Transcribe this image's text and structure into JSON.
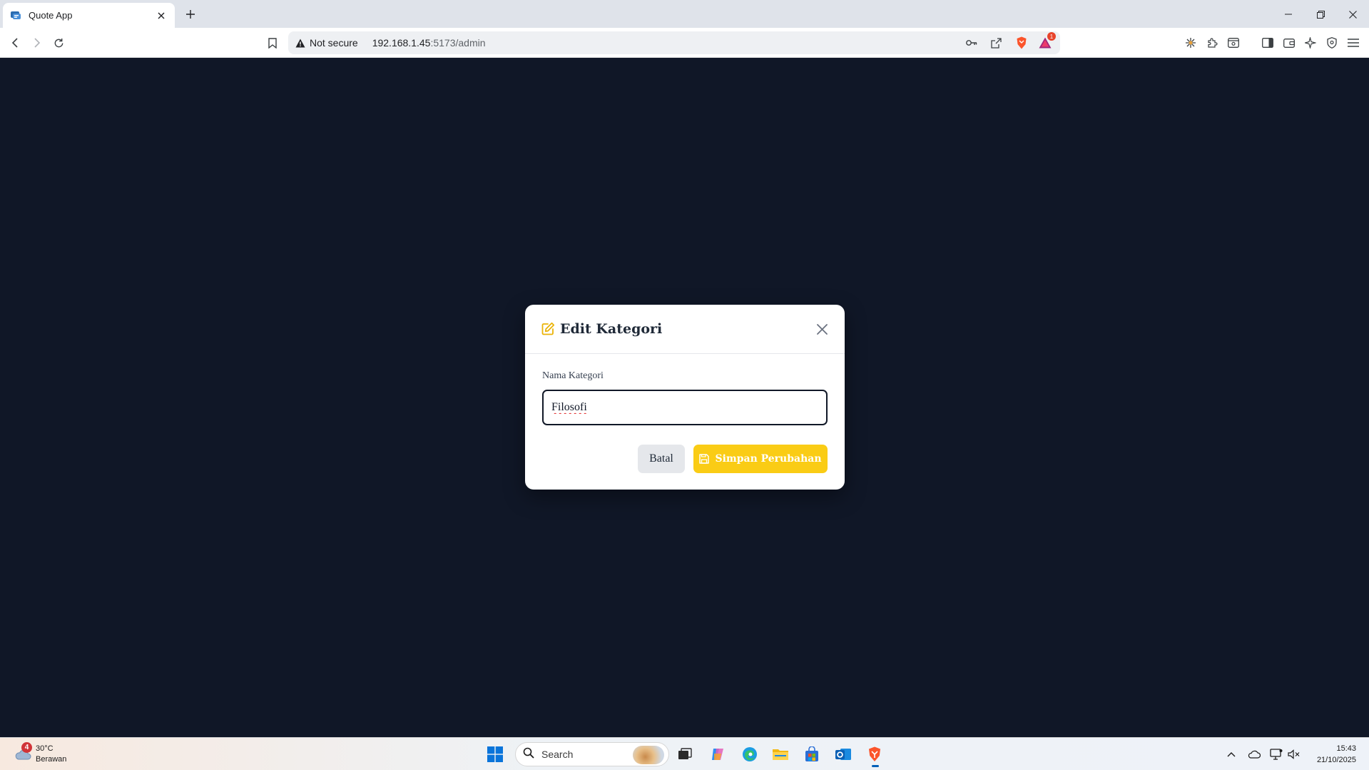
{
  "browser": {
    "tab_title": "Quote App",
    "url_prefix": "192.168.1.45",
    "url_suffix": ":5173/admin",
    "not_secure_label": "Not secure",
    "rewards_badge_count": "1"
  },
  "modal": {
    "title": "Edit Kategori",
    "field_label": "Nama Kategori",
    "field_value": "Filosofi",
    "cancel_label": "Batal",
    "save_label": "Simpan Perubahan"
  },
  "taskbar": {
    "weather_temp": "30°C",
    "weather_desc": "Berawan",
    "weather_badge": "4",
    "search_placeholder": "Search",
    "time": "15:43",
    "date": "21/10/2025"
  },
  "colors": {
    "page_bg": "#101727",
    "accent_yellow": "#facc15",
    "edit_icon": "#eab308"
  }
}
